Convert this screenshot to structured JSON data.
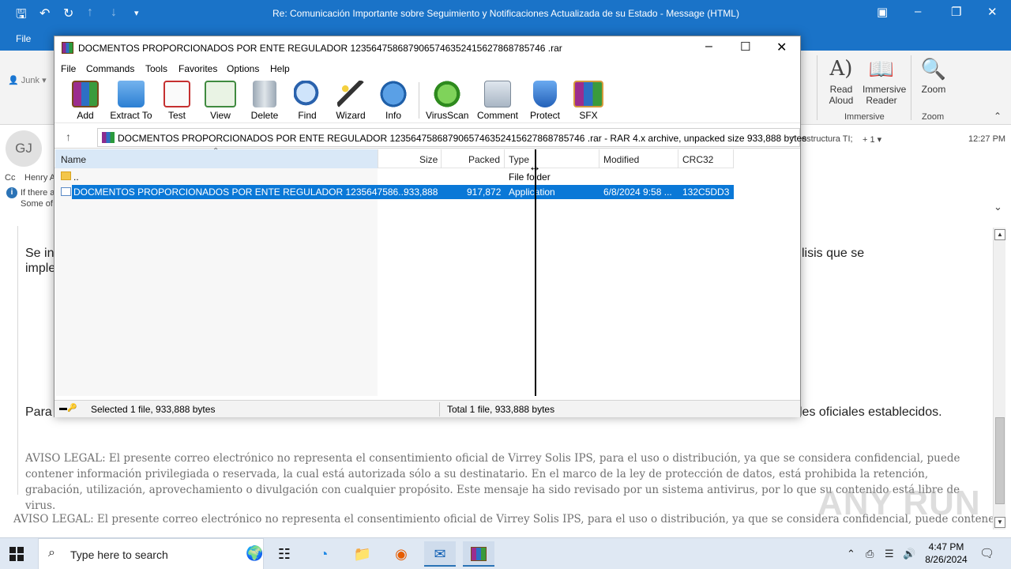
{
  "outlook": {
    "title": "Re: Comunicación Importante sobre Seguimiento y Notificaciones Actualizada de su Estado  -  Message (HTML)",
    "file_tab": "File",
    "junk_label": "Junk",
    "ribbon": {
      "read_aloud": "Read Aloud",
      "immersive_reader": "Immersive Reader",
      "immersive_group": "Immersive",
      "zoom": "Zoom",
      "zoom_group": "Zoom"
    },
    "header": {
      "avatar_initials": "GJ",
      "cc_label": "Cc",
      "cc_name": "Henry A",
      "info_line1": "If there a",
      "info_line2": "Some of",
      "right_text": "estructura TI;",
      "more_recipients": "+ 1",
      "time": "12:27 PM"
    },
    "body": {
      "line1_start": "Se in",
      "line1_end": "lisis que se",
      "line2_start": "imple",
      "line3_start": "Para",
      "line3_end": "les oficiales establecidos.",
      "legal1": "AVISO LEGAL: El presente correo electrónico no representa el consentimiento oficial de Virrey Solis IPS, para el uso o distribución, ya que se considera confidencial, puede contener información privilegiada o reservada, la cual está autorizada sólo a su destinatario. En el marco de la ley de protección de datos, está prohibida la retención, grabación, utilización, aprovechamiento o divulgación con cualquier propósito. Este mensaje ha sido revisado por un sistema antivirus, por lo que su contenido está libre de virus.",
      "legal2": "AVISO LEGAL: El presente correo electrónico no representa el consentimiento oficial de Virrey Solis IPS, para el uso o distribución, ya que se considera confidencial, puede contener"
    },
    "watermark": "ANY RUN"
  },
  "winrar": {
    "title": "DOCMENTOS PROPORCIONADOS POR ENTE REGULADOR 1235647586879065746352415627868785746 .rar",
    "menu": [
      "File",
      "Commands",
      "Tools",
      "Favorites",
      "Options",
      "Help"
    ],
    "toolbar": [
      "Add",
      "Extract To",
      "Test",
      "View",
      "Delete",
      "Find",
      "Wizard",
      "Info",
      "VirusScan",
      "Comment",
      "Protect",
      "SFX"
    ],
    "path": "DOCMENTOS PROPORCIONADOS POR ENTE REGULADOR 1235647586879065746352415627868785746 .rar - RAR 4.x archive, unpacked size 933,888 bytes",
    "columns": {
      "name": "Name",
      "size": "Size",
      "packed": "Packed",
      "type": "Type",
      "modified": "Modified",
      "crc": "CRC32"
    },
    "rows": [
      {
        "name": "..",
        "size": "",
        "packed": "",
        "type": "File folder",
        "modified": "",
        "crc": ""
      },
      {
        "name": "DOCMENTOS PROPORCIONADOS POR ENTE REGULADOR 1235647586...",
        "size": "933,888",
        "packed": "917,872",
        "type": "Application",
        "modified": "6/8/2024 9:58 ...",
        "crc": "132C5DD3"
      }
    ],
    "status_left": "Selected 1 file, 933,888 bytes",
    "status_right": "Total 1 file, 933,888 bytes"
  },
  "taskbar": {
    "search_placeholder": "Type here to search",
    "time": "4:47 PM",
    "date": "8/26/2024"
  },
  "colors": {
    "outlook_blue": "#1a73c8",
    "selection_blue": "#0a78d7",
    "legal_gray": "#707070"
  }
}
